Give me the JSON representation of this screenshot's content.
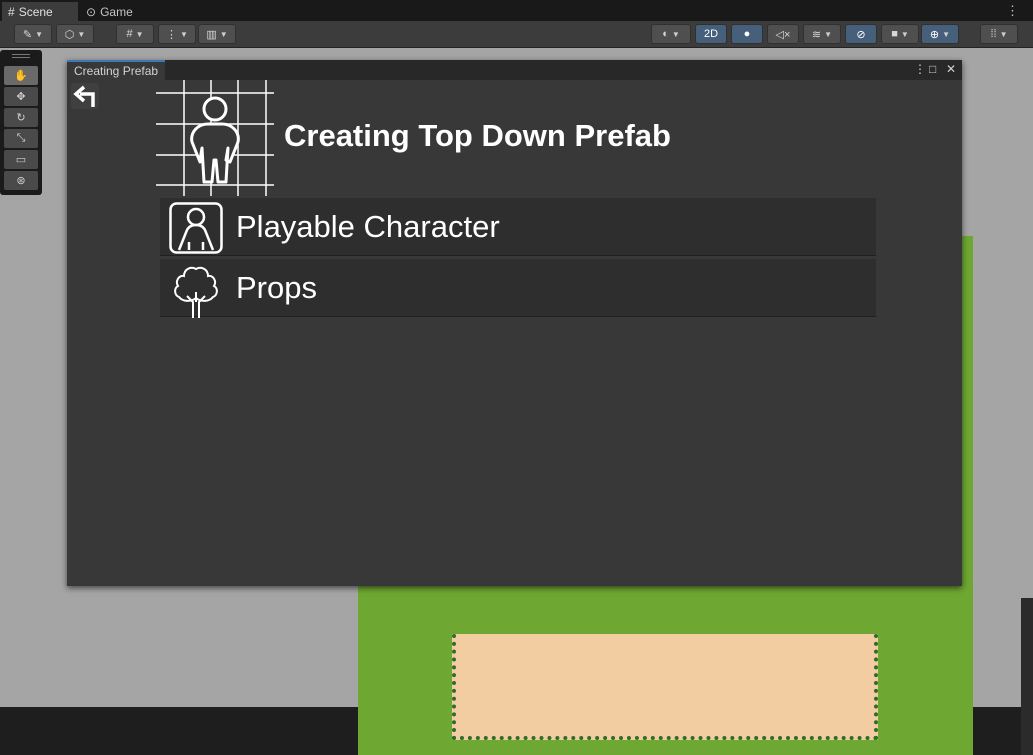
{
  "tabs": {
    "scene": "Scene",
    "game": "Game"
  },
  "toolbar": {
    "mode_2d": "2D"
  },
  "window": {
    "title": "Creating Prefab",
    "heading": "Creating Top Down Prefab",
    "items": [
      {
        "label": "Playable Character",
        "icon": "character-icon"
      },
      {
        "label": "Props",
        "icon": "tree-icon"
      }
    ]
  },
  "colors": {
    "accent": "#46607c",
    "window_bg": "#383838",
    "grass": "#6ea833",
    "sand": "#f2cda1"
  }
}
